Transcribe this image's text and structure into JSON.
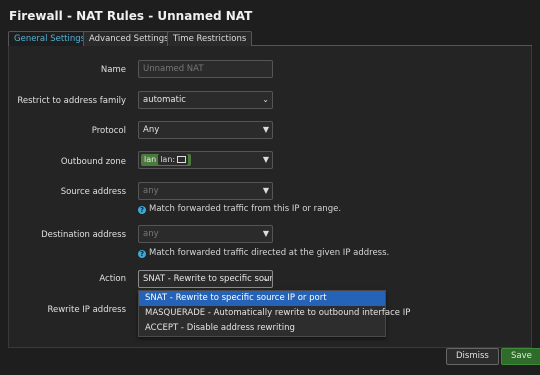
{
  "window": {
    "title": "Firewall - NAT Rules - Unnamed NAT"
  },
  "tabs": [
    {
      "label": "General Settings",
      "active": true
    },
    {
      "label": "Advanced Settings",
      "active": false
    },
    {
      "label": "Time Restrictions",
      "active": false
    }
  ],
  "form": {
    "name": {
      "label": "Name",
      "placeholder": "Unnamed NAT",
      "value": ""
    },
    "family": {
      "label": "Restrict to address family",
      "value": "automatic"
    },
    "protocol": {
      "label": "Protocol",
      "value": "Any"
    },
    "outbound_zone": {
      "label": "Outbound zone",
      "zone_name": "lan",
      "zone_inner": "lan:"
    },
    "source": {
      "label": "Source address",
      "value": "any",
      "hint": "Match forwarded traffic from this IP or range."
    },
    "destination": {
      "label": "Destination address",
      "value": "any",
      "hint": "Match forwarded traffic directed at the given IP address."
    },
    "action": {
      "label": "Action",
      "value": "SNAT - Rewrite to specific sourc"
    },
    "rewrite_ip": {
      "label": "Rewrite IP address"
    }
  },
  "action_menu": [
    {
      "label": "SNAT - Rewrite to specific source IP or port",
      "selected": true
    },
    {
      "label": "MASQUERADE - Automatically rewrite to outbound interface IP",
      "selected": false
    },
    {
      "label": "ACCEPT - Disable address rewriting",
      "selected": false
    }
  ],
  "buttons": {
    "dismiss": "Dismiss",
    "save": "Save"
  },
  "colors": {
    "accent": "#53b3d8",
    "save": "#2f6b2a",
    "selection": "#2563b8",
    "zone": "#4a7a3e"
  }
}
